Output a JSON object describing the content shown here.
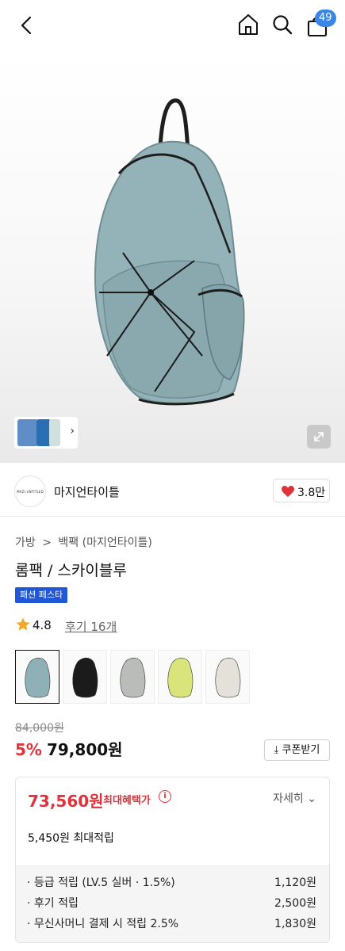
{
  "header": {
    "cart_count": "49"
  },
  "seller": {
    "logo_text": "MAZI UNTITLED",
    "name": "마지언타이틀",
    "like_count": "3.8만"
  },
  "breadcrumb": {
    "level1": "가방",
    "separator": ">",
    "level2": "백팩 (마지언타이틀)"
  },
  "product": {
    "title": "롬팩 / 스카이블루",
    "tag": "패션 페스타",
    "rating": "4.8",
    "review_link": "후기 16개"
  },
  "price": {
    "original": "84,000원",
    "discount": "5%",
    "sale": "79,800원",
    "coupon_label": "쿠폰받기"
  },
  "benefit": {
    "max_price": "73,560원",
    "max_label": "최대혜택가",
    "detail_label": "자세히",
    "points_summary": "5,450원 최대적립",
    "rows": [
      {
        "label": "· 등급 적립 (LV.5 실버 · 1.5%)",
        "value": "1,120원"
      },
      {
        "label": "· 후기 적립",
        "value": "2,500원"
      },
      {
        "label": "· 무신사머니 결제 시 적립 2.5%",
        "value": "1,830원"
      }
    ]
  },
  "colors": {
    "accent_red": "#e0323b",
    "badge_blue": "#3a86e6",
    "tag_blue": "#1f57d6",
    "swatches": [
      "#8fb0b6",
      "#1b1b1b",
      "#b9bcb8",
      "#d9e57a",
      "#e4e0da"
    ]
  }
}
